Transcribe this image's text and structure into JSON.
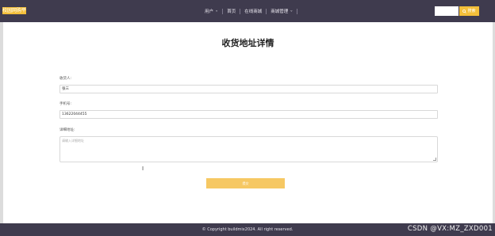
{
  "header": {
    "logo_text": "校园网购平台",
    "nav": [
      {
        "label": "用户",
        "has_dropdown": true
      },
      {
        "label": "首页",
        "has_dropdown": false
      },
      {
        "label": "在线商城",
        "has_dropdown": false
      },
      {
        "label": "商城管理",
        "has_dropdown": true
      }
    ],
    "search": {
      "placeholder": "",
      "button_label": "搜索"
    },
    "colors": {
      "bar": "#3f3b4e",
      "accent": "#f3bf3a"
    }
  },
  "page": {
    "title": "收货地址详情"
  },
  "form": {
    "receiver": {
      "label": "收货人:",
      "value": "张三"
    },
    "phone": {
      "label": "手机号:",
      "value": "13622044455"
    },
    "address": {
      "label": "详细地址:",
      "placeholder": "请输入详细地址"
    },
    "submit_label": "提交"
  },
  "footer": {
    "text": "© Copyright buildmix2024. All right reserved."
  },
  "watermark": "CSDN @VX:MZ_ZXD001"
}
